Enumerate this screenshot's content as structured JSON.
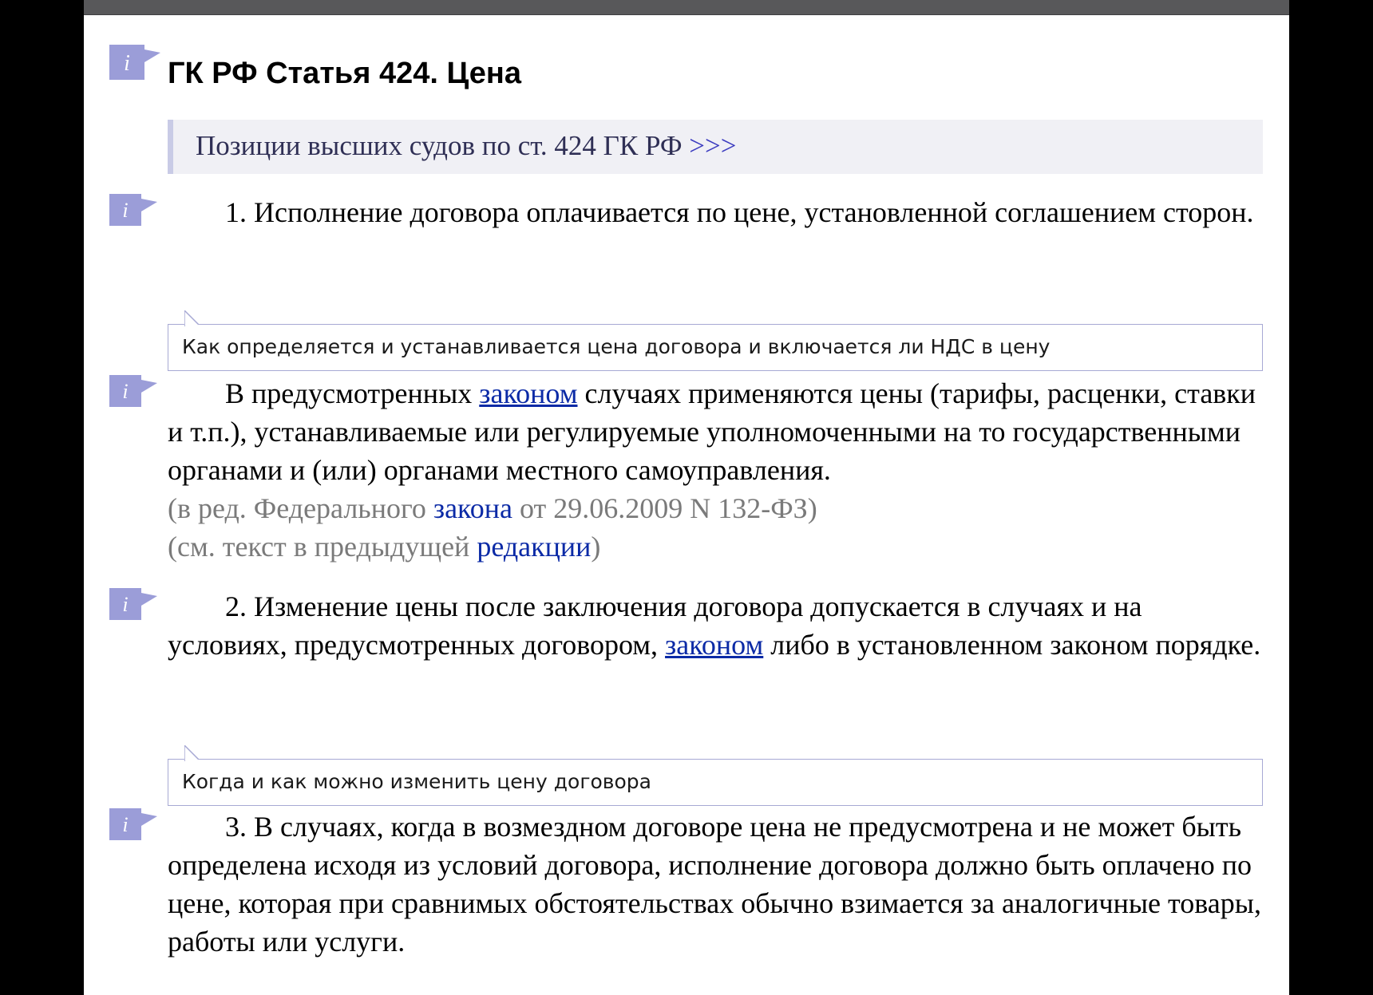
{
  "article": {
    "title": "ГК РФ Статья 424. Цена"
  },
  "positions_banner": {
    "text": "Позиции высших судов по ст. 424 ГК РФ",
    "link": ">>>"
  },
  "paragraphs": {
    "p1": {
      "text": "1. Исполнение договора оплачивается по цене, установленной соглашением сторон."
    },
    "callout1": "Как определяется и устанавливается цена договора и включается ли НДС в цену",
    "p2": {
      "pre": "В предусмотренных ",
      "link": "законом",
      "post": " случаях применяются цены (тарифы, расценки, ставки и т.п.), устанавливаемые или регулируемые уполномоченными на то государственными органами и (или) органами местного самоуправления.",
      "note1_pre": "(в ред. Федерального ",
      "note1_link": "закона",
      "note1_post": " от 29.06.2009 N 132-ФЗ)",
      "note2_pre": "(см. текст в предыдущей ",
      "note2_link": "редакции",
      "note2_post": ")"
    },
    "p3": {
      "pre": "2. Изменение цены после заключения договора допускается в случаях и на условиях, предусмотренных договором, ",
      "link": "законом",
      "post": " либо в установленном законом порядке."
    },
    "callout2": "Когда и как можно изменить цену договора",
    "p4": {
      "text": "3. В случаях, когда в возмездном договоре цена не предусмотрена и не может быть определена исходя из условий договора, исполнение договора должно быть оплачено по цене, которая при сравнимых обстоятельствах обычно взимается за аналогичные товары, работы или услуги."
    }
  },
  "icons": {
    "paragraph_info": "info-flag-icon"
  },
  "colors": {
    "icon": "#9b9dd8",
    "link": "#0b2aa6",
    "banner_bg": "#f0f0f5",
    "callout_border": "#a7a9d4",
    "note_text": "#7a7a7a"
  }
}
